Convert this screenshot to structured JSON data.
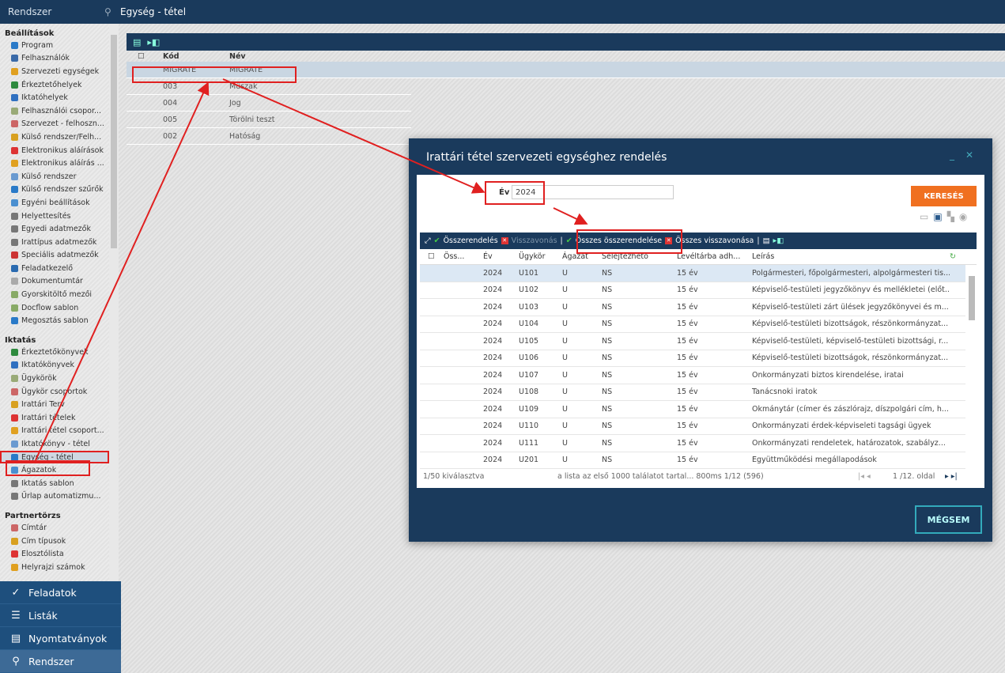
{
  "topbar": {
    "brand": "Rendszer",
    "breadcrumb": "Egység - tétel"
  },
  "sidebar": {
    "sections": [
      {
        "title": "Beállítások",
        "items": [
          "Program",
          "Felhasználók",
          "Szervezeti egységek",
          "Érkeztetőhelyek",
          "Iktatóhelyek",
          "Felhasználói csopor...",
          "Szervezet - felhoszn...",
          "Külső rendszer/Felh...",
          "Elektronikus aláírások",
          "Elektronikus aláírás ...",
          "Külső rendszer",
          "Külső rendszer szűrők",
          "Egyéni beállítások",
          "Helyettesítés",
          "Egyedi adatmezők",
          "Irattípus adatmezők",
          "Speciális adatmezők",
          "Feladatkezelő",
          "Dokumentumtár",
          "Gyorskitöltő mezői",
          "Docflow sablon",
          "Megosztás sablon"
        ]
      },
      {
        "title": "Iktatás",
        "items": [
          "Érkeztetőkönyvek",
          "Iktatókönyvek",
          "Ügykörök",
          "Ügykör csoportok",
          "Irattári Terv",
          "Irattári tételek",
          "Irattári tétel csoport...",
          "Iktatókönyv - tétel",
          "Egység - tétel",
          "Ágazatok",
          "Iktatás sablon",
          "Űrlap automatizmu..."
        ]
      },
      {
        "title": "Partnertörzs",
        "items": [
          "Címtár",
          "Cím típusok",
          "Elosztólista",
          "Helyrajzi számok"
        ]
      }
    ]
  },
  "bottomnav": [
    "Feladatok",
    "Listák",
    "Nyomtatványok",
    "Rendszer"
  ],
  "grid": {
    "headers": {
      "kod": "Kód",
      "nev": "Név"
    },
    "rows": [
      {
        "kod": "MIGRATE",
        "nev": "MIGRATE"
      },
      {
        "kod": "003",
        "nev": "Műszak"
      },
      {
        "kod": "004",
        "nev": "Jog"
      },
      {
        "kod": "005",
        "nev": "Törölni teszt"
      },
      {
        "kod": "002",
        "nev": "Hatóság"
      }
    ]
  },
  "modal": {
    "title": "Irattári tétel szervezeti egységhez rendelés",
    "ev_label": "Év",
    "ev_value": "2024",
    "search_btn": "KERESÉS",
    "toolbar": {
      "assign": "Összerendelés",
      "revoke": "Visszavonás",
      "assign_all": "Összes összerendelése",
      "revoke_all": "Összes visszavonása"
    },
    "headers": [
      "Öss...",
      "Év",
      "Ügykör",
      "Ágazat",
      "Selejtezhető",
      "Levéltárba adh...",
      "Leírás"
    ],
    "rows": [
      [
        "2024",
        "U101",
        "U",
        "NS",
        "15 év",
        "Polgármesteri, főpolgármesteri, alpolgármesteri tis..."
      ],
      [
        "2024",
        "U102",
        "U",
        "NS",
        "15 év",
        "Képviselő-testületi jegyzőkönyv és mellékletei (előt..."
      ],
      [
        "2024",
        "U103",
        "U",
        "NS",
        "15 év",
        "Képviselő-testületi zárt ülések jegyzőkönyvei és m..."
      ],
      [
        "2024",
        "U104",
        "U",
        "NS",
        "15 év",
        "Képviselő-testületi bizottságok, részönkormányzat..."
      ],
      [
        "2024",
        "U105",
        "U",
        "NS",
        "15 év",
        "Képviselő-testületi, képviselő-testületi bizottsági, r..."
      ],
      [
        "2024",
        "U106",
        "U",
        "NS",
        "15 év",
        "Képviselő-testületi bizottságok, részönkormányzat..."
      ],
      [
        "2024",
        "U107",
        "U",
        "NS",
        "15 év",
        "Önkormányzati biztos kirendelése, iratai"
      ],
      [
        "2024",
        "U108",
        "U",
        "NS",
        "15 év",
        "Tanácsnoki iratok"
      ],
      [
        "2024",
        "U109",
        "U",
        "NS",
        "15 év",
        "Okmánytár (címer és zászlórajz, díszpolgári cím, h..."
      ],
      [
        "2024",
        "U110",
        "U",
        "NS",
        "15 év",
        "Önkormányzati érdek-képviseleti tagsági ügyek"
      ],
      [
        "2024",
        "U111",
        "U",
        "NS",
        "15 év",
        "Önkormányzati rendeletek, határozatok, szabályz..."
      ],
      [
        "2024",
        "U201",
        "U",
        "NS",
        "15 év",
        "Együttműködési megállapodások"
      ]
    ],
    "status_left": "1/50 kiválasztva",
    "status_mid": "a lista az első 1000 találatot tartal... 800ms 1/12 (596)",
    "pager": "1 /12. oldal",
    "cancel": "MÉGSEM"
  },
  "colors": {
    "navy": "#1a3a5c",
    "accent": "#f07020",
    "annotation": "#e02020"
  }
}
